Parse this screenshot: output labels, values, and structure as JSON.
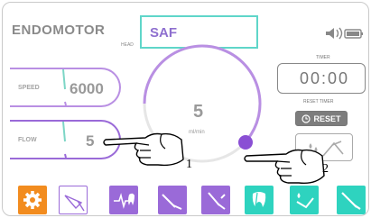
{
  "header": {
    "title": "ENDOMOTOR",
    "head_label": "HEAD",
    "head_value": "SAF"
  },
  "speed": {
    "label": "SPEED",
    "value": "6000"
  },
  "flow": {
    "label": "FLOW",
    "value": "5"
  },
  "dial": {
    "value": "5",
    "unit": "ml/min"
  },
  "timer": {
    "label": "TIMER",
    "value": "00:00",
    "reset_label": "RESET TIMER",
    "reset_button": "RESET"
  },
  "callouts": {
    "one": "1",
    "two": "2"
  },
  "colors": {
    "accent_purple": "#9a6ad8",
    "accent_teal": "#2ed3bf",
    "accent_orange": "#f28c1f"
  },
  "toolbar": {
    "icons": [
      "gear-icon",
      "file-instrument-icon",
      "heartbeat-tooth-icon",
      "file-instrument-icon",
      "file-instrument-icon",
      "tooth-icon",
      "drops-instrument-icon",
      "file-instrument-icon"
    ]
  }
}
